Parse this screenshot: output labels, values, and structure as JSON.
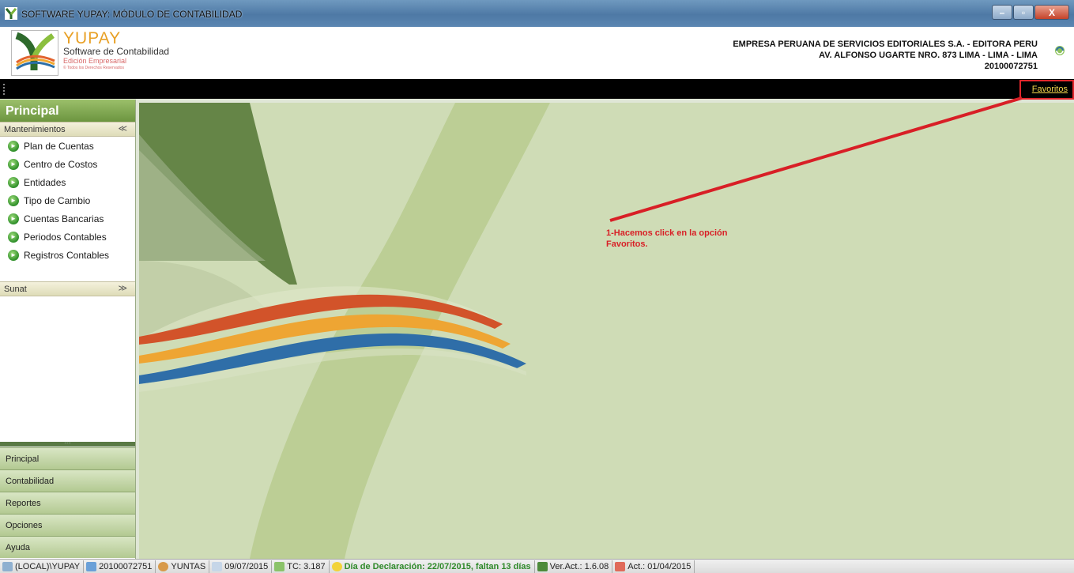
{
  "window": {
    "title": "SOFTWARE YUPAY: MÓDULO DE CONTABILIDAD",
    "minimize": "–",
    "maximize": "▫",
    "close": "X"
  },
  "header": {
    "brand_name": "YUPAY",
    "brand_subtitle": "Software de Contabilidad",
    "brand_edition": "Edición Empresarial",
    "brand_rights": "© Todos los Derechos Reservados",
    "company_name": "EMPRESA PERUANA DE SERVICIOS EDITORIALES S.A. - EDITORA PERU",
    "company_address": "AV. ALFONSO UGARTE NRO. 873 LIMA - LIMA - LIMA",
    "company_ruc": "20100072751"
  },
  "toolbar": {
    "favoritos_label": "Favoritos"
  },
  "sidebar": {
    "title": "Principal",
    "sections": [
      {
        "label": "Mantenimientos",
        "chevron": "≪",
        "items": [
          {
            "label": "Plan de Cuentas"
          },
          {
            "label": "Centro de Costos"
          },
          {
            "label": "Entidades"
          },
          {
            "label": "Tipo de Cambio"
          },
          {
            "label": "Cuentas Bancarias"
          },
          {
            "label": "Periodos Contables"
          },
          {
            "label": "Registros Contables"
          }
        ]
      },
      {
        "label": "Sunat",
        "chevron": "≫",
        "items": []
      }
    ],
    "splitter_dots": ".....",
    "nav": [
      {
        "label": "Principal"
      },
      {
        "label": "Contabilidad"
      },
      {
        "label": "Reportes"
      },
      {
        "label": "Opciones"
      },
      {
        "label": "Ayuda"
      }
    ]
  },
  "annotation": {
    "line1": "1-Hacemos click en la opción",
    "line2": "Favoritos."
  },
  "statusbar": {
    "server": "(LOCAL)\\YUPAY",
    "ruc": "20100072751",
    "user": "YUNTAS",
    "date": "09/07/2015",
    "tc": "TC: 3.187",
    "declaracion": "Día de Declaración: 22/07/2015, faltan 13 días",
    "version": "Ver.Act.: 1.6.08",
    "act": "Act.: 01/04/2015"
  },
  "colors": {
    "annotation_red": "#d81f26",
    "favoritos_yellow": "#f4d64c",
    "sidebar_green": "#6c9540"
  }
}
